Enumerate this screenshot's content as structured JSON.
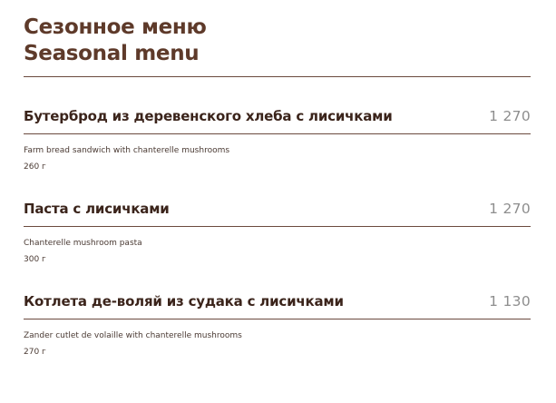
{
  "header": {
    "title_ru": "Сезонное меню",
    "title_en": "Seasonal menu"
  },
  "items": [
    {
      "name": "Бутерброд из деревенского хлеба с лисичками",
      "price": "1 270",
      "description": "Farm bread sandwich with chanterelle mushrooms",
      "weight": "260 г"
    },
    {
      "name": "Паста с лисичками",
      "price": "1 270",
      "description": "Chanterelle mushroom pasta",
      "weight": "300 г"
    },
    {
      "name": "Котлета де-воляй из судака с лисичками",
      "price": "1 130",
      "description": "Zander cutlet de volaille with chanterelle mushrooms",
      "weight": "270 г"
    }
  ],
  "colors": {
    "title": "#5e3a2a",
    "item_name": "#3b241b",
    "price": "#8e8e8e",
    "rule": "#6b4a3e"
  }
}
